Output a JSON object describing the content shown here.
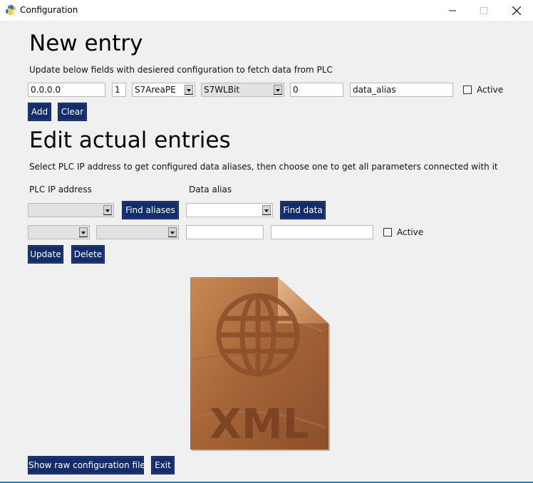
{
  "window": {
    "title": "Configuration",
    "minimize_icon": "minimize-icon",
    "maximize_icon": "maximize-icon",
    "close_icon": "close-icon"
  },
  "new_entry": {
    "heading": "New entry",
    "description": "Update below fields with desiered configuration to fetch data from PLC",
    "ip_value": "0.0.0.0",
    "rack_value": "1",
    "area_value": "S7AreaPE",
    "wordlen_value": "S7WLBit",
    "start_value": "0",
    "alias_value": "data_alias",
    "active_label": "Active",
    "add_label": "Add",
    "clear_label": "Clear"
  },
  "edit": {
    "heading": "Edit actual entries",
    "description": "Select PLC IP address to get configured data aliases, then choose one to get all parameters connected with it",
    "plc_ip_label": "PLC IP address",
    "data_alias_label": "Data alias",
    "find_aliases_label": "Find aliases",
    "find_data_label": "Find data",
    "active_label": "Active",
    "update_label": "Update",
    "delete_label": "Delete"
  },
  "illustration": {
    "icon": "xml-globe-file-icon",
    "text": "XML"
  },
  "footer": {
    "show_raw_label": "Show raw configuration file",
    "exit_label": "Exit"
  },
  "colors": {
    "button_bg": "#142c6a",
    "window_bg": "#f0f0f0",
    "wood": "#a8663a"
  }
}
